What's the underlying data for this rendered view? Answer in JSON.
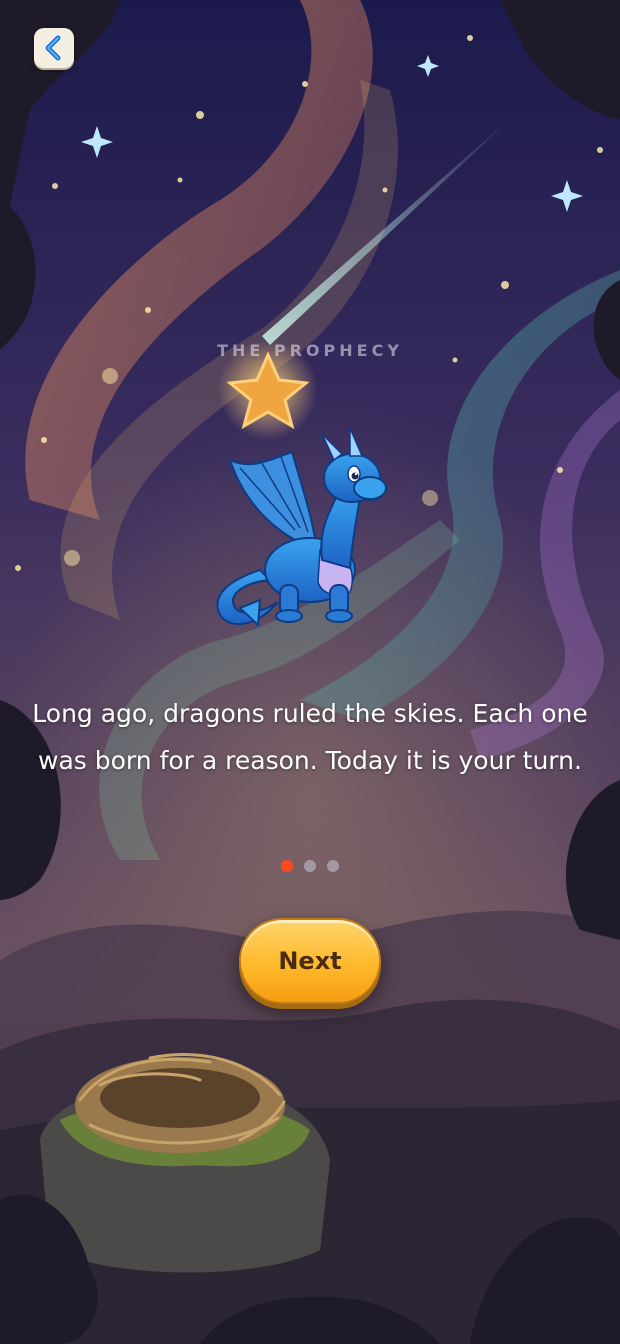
{
  "intro": {
    "title": "THE PROPHECY",
    "story": "Long ago, dragons ruled the skies. Each one was born for a reason. Today it is your turn.",
    "next_label": "Next",
    "pages": {
      "current": 1,
      "total": 3
    }
  },
  "nav": {
    "back_icon": "chevron-left-icon"
  },
  "colors": {
    "accent_dot": "#ff4a1c",
    "button": "#ffb92c",
    "button_text": "#4a2c10",
    "sky_top": "#1e1a4a",
    "dragon": "#2f8fe0"
  }
}
